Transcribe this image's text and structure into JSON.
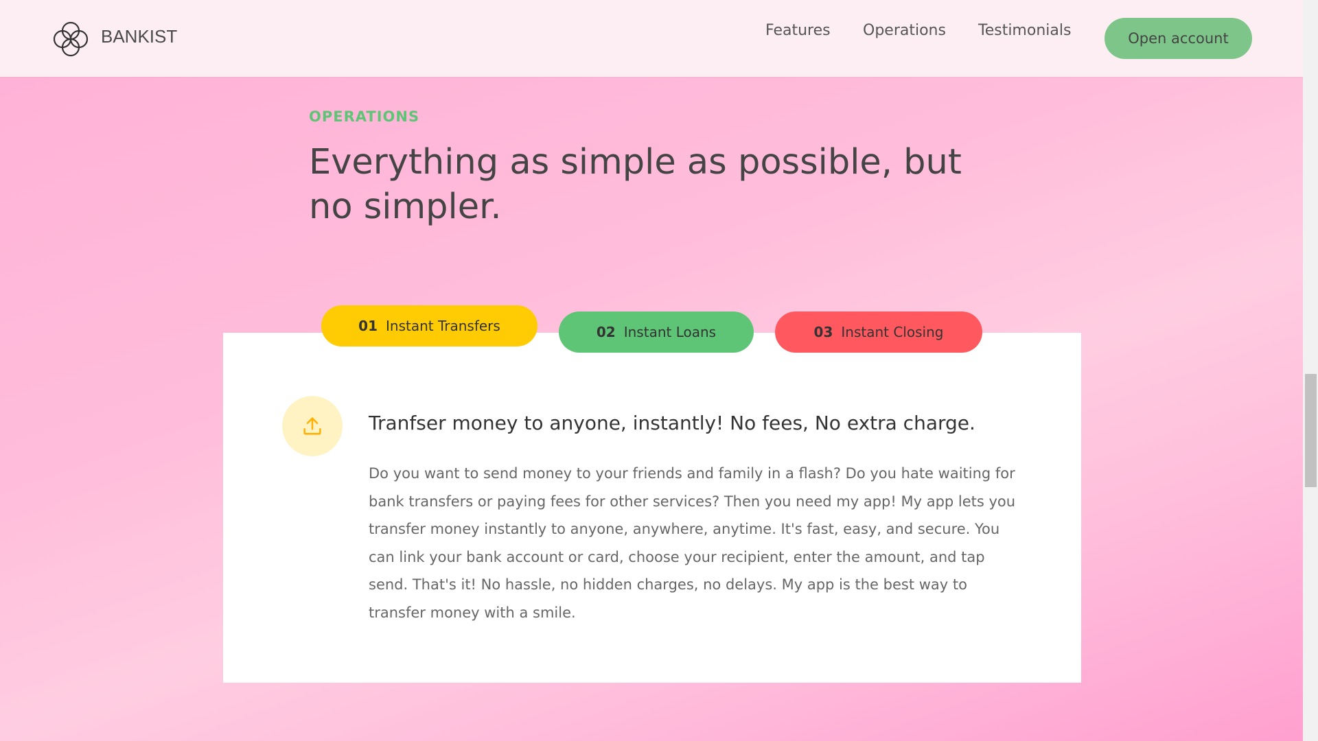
{
  "header": {
    "brand": "BANKIST",
    "logo_icon": "bankist-logo-icon",
    "nav": {
      "features": "Features",
      "operations": "Operations",
      "testimonials": "Testimonials"
    },
    "cta": "Open account"
  },
  "section": {
    "label": "OPERATIONS",
    "title": "Everything as simple as possible, but no simpler."
  },
  "tabs": [
    {
      "num": "01",
      "label": "Instant Transfers",
      "color": "#ffcb03",
      "active": true
    },
    {
      "num": "02",
      "label": "Instant Loans",
      "color": "#5ec576",
      "active": false
    },
    {
      "num": "03",
      "label": "Instant Closing",
      "color": "#ff585f",
      "active": false
    }
  ],
  "content": {
    "icon": "upload-icon",
    "heading": "Tranfser money to anyone, instantly! No fees, No extra charge.",
    "text": "Do you want to send money to your friends and family in a flash? Do you hate waiting for bank transfers or paying fees for other services? Then you need my app! My app lets you transfer money instantly to anyone, anywhere, anytime. It's fast, easy, and secure. You can link your bank account or card, choose your recipient, enter the amount, and tap send. That's it! No hassle, no hidden charges, no delays. My app is the best way to transfer money with a smile."
  },
  "colors": {
    "accent_green": "#5ec576",
    "accent_yellow": "#ffcb03",
    "accent_red": "#ff585f"
  }
}
